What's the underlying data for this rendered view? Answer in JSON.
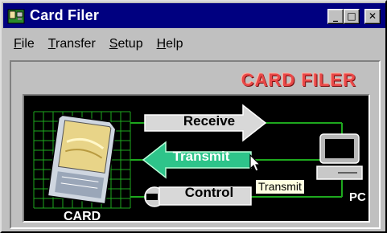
{
  "window": {
    "title": "Card Filer"
  },
  "titlebar_buttons": {
    "minimize_glyph": "_",
    "maximize_glyph": "□",
    "close_glyph": "✕"
  },
  "menu": {
    "items": [
      "File",
      "Transfer",
      "Setup",
      "Help"
    ]
  },
  "logo": {
    "text": "CARD FILER"
  },
  "diagram": {
    "card_label": "CARD",
    "pc_label": "PC",
    "receive_label": "Receive",
    "transmit_label": "Transmit",
    "control_label": "Control"
  },
  "tooltip": {
    "text": "Transmit"
  },
  "colors": {
    "titlebar": "#000080",
    "transmit_arrow": "#2ec48a",
    "grid": "#1ea81e",
    "logo": "#e84848",
    "tooltip_bg": "#ffffe1"
  }
}
